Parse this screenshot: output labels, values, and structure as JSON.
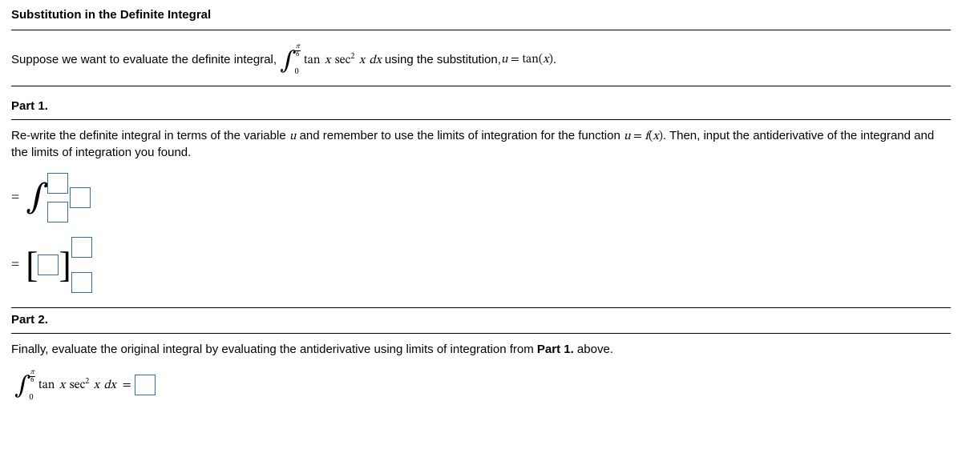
{
  "title": "Substitution in the Definite Integral",
  "intro": {
    "pre": "Suppose we want to evaluate the definite integral, ",
    "upper_num": "π",
    "upper_den": "6",
    "lower": "0",
    "integrand_a": "tan",
    "integrand_b": "x",
    "integrand_c": "sec",
    "integrand_d": "2",
    "integrand_e": "x",
    "integrand_f": "dx",
    "mid": " using the substitution, ",
    "sub_lhs": "u",
    "sub_eq": " = ",
    "sub_rhs_a": "tan(",
    "sub_rhs_b": "x",
    "sub_rhs_c": ")",
    "period": "."
  },
  "part1": {
    "header": "Part 1.",
    "instr_a": "Re-write the definite integral in terms of the variable ",
    "instr_b": "u",
    "instr_c": " and remember to use the limits of integration for the function ",
    "instr_d": "u",
    "instr_e": " = ",
    "instr_f": "f",
    "instr_g": "(",
    "instr_h": "x",
    "instr_i": ")",
    "instr_j": ". Then, input the antiderivative of the integrand and the limits of integration you found."
  },
  "part2": {
    "header": "Part 2.",
    "instr_a": "Finally, evaluate the original integral by evaluating the antiderivative using limits of integration from ",
    "instr_b": "Part 1.",
    "instr_c": " above.",
    "upper_num": "π",
    "upper_den": "6",
    "lower": "0",
    "integrand_a": "tan",
    "integrand_b": "x",
    "integrand_c": "sec",
    "integrand_d": "2",
    "integrand_e": "x",
    "integrand_f": "dx",
    "eq": " ="
  }
}
